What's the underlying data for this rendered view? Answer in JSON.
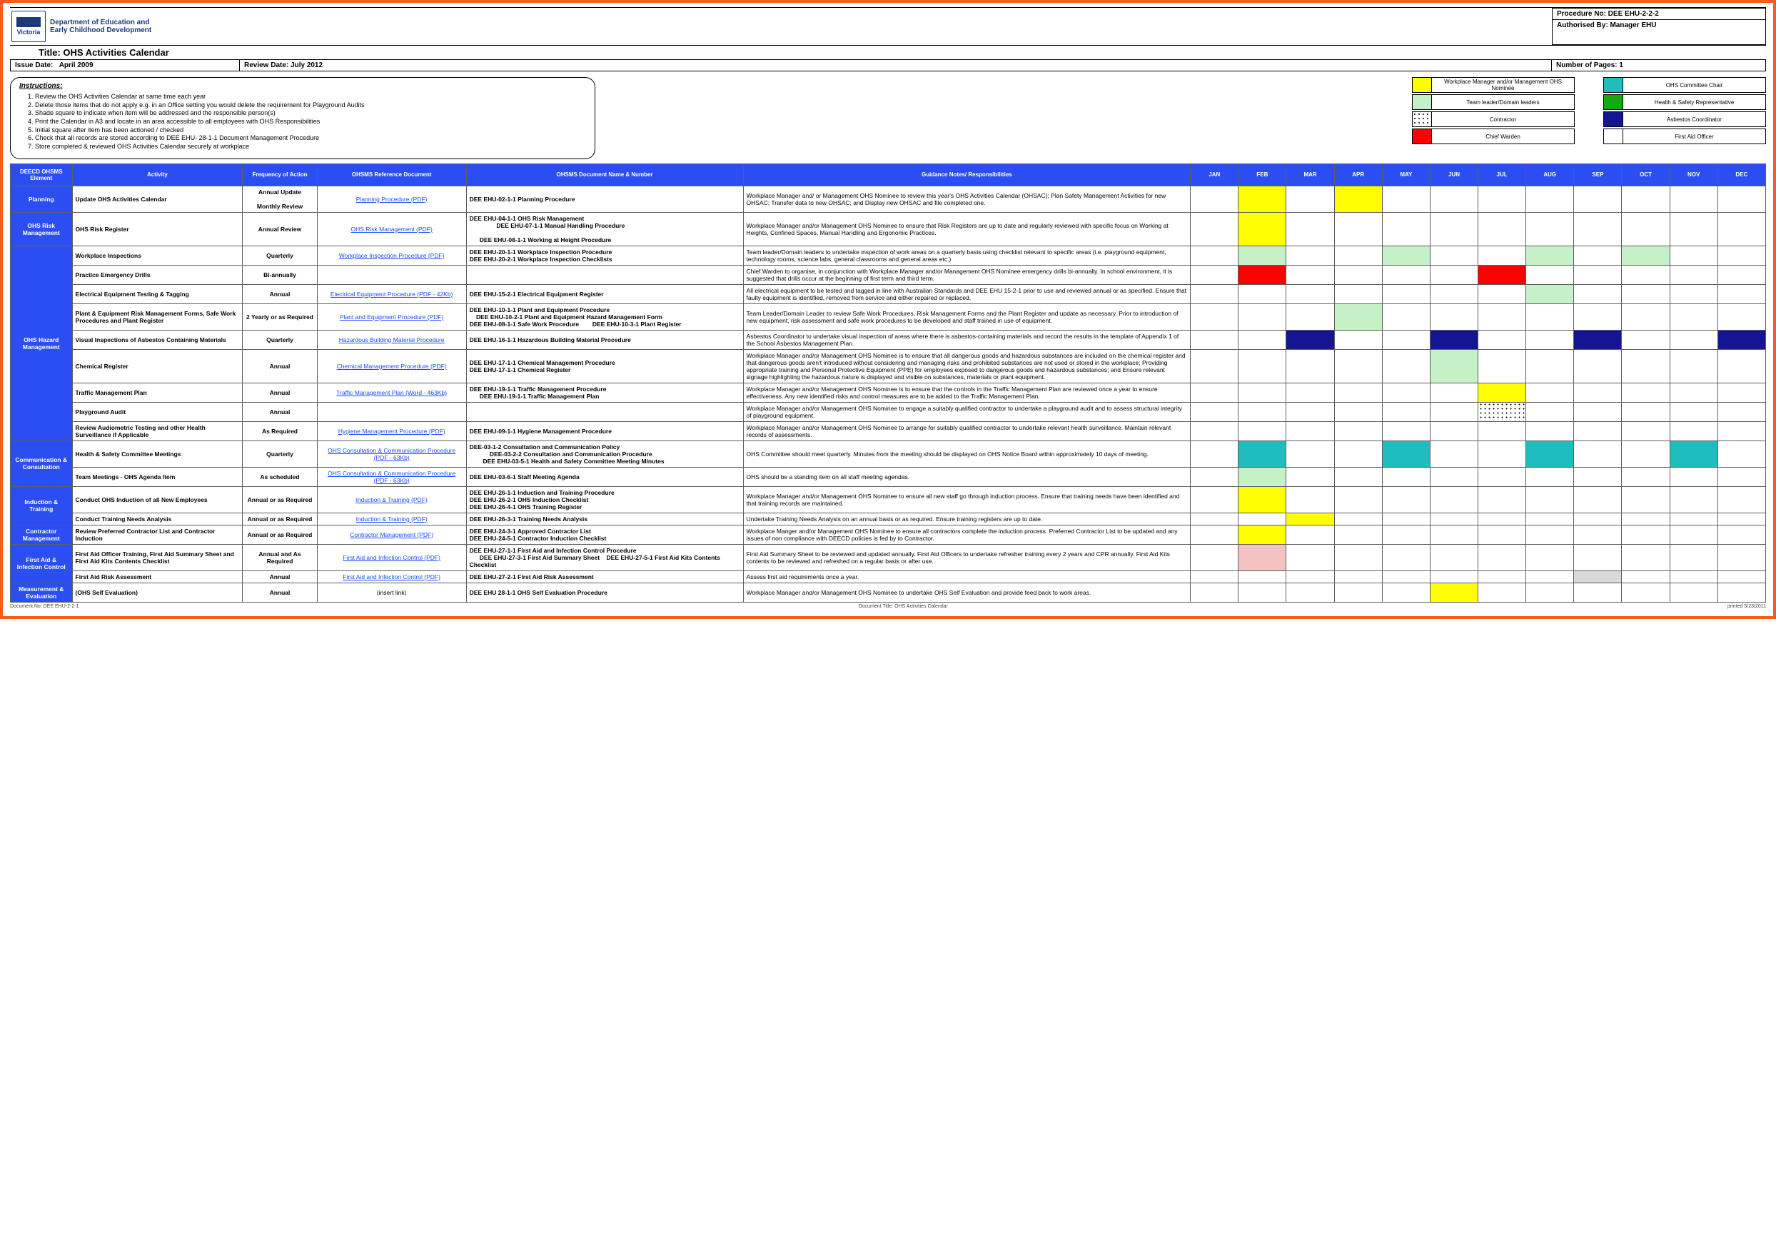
{
  "header": {
    "dept_line1": "Department of Education and",
    "dept_line2": "Early Childhood Development",
    "state": "Victoria",
    "title": "Title: OHS Activities Calendar",
    "procedure_no": "Procedure No: DEE EHU-2-2-2",
    "authorised_by": "Authorised By: Manager EHU",
    "issue_date_label": "Issue Date:",
    "issue_date_value": "April 2009",
    "review_date_label": "Review Date: July 2012",
    "pages_label": "Number of Pages: 1"
  },
  "instructions": {
    "heading": "Instructions:",
    "items": [
      "Review the OHS Activities Calendar at same time each year",
      "Delete those items that do not apply e.g. in an Office setting you would delete the requirement for Playground Audits",
      "Shade square to indicate when item will be addressed and the responsible person(s)",
      "Print the Calendar in A3 and locate in an area accessible to all employees with OHS Responsibilities",
      "Initial square after item has been actioned / checked",
      "Check that all records are stored according to DEE EHU- 28-1-1 Document Management Procedure",
      "Store completed & reviewed OHS Activities Calendar securely at workplace"
    ]
  },
  "legend": {
    "left": [
      {
        "sw": "sw-yellow",
        "label": "Workplace Manager and/or Management OHS Nominee"
      },
      {
        "sw": "sw-lgreen",
        "label": "Team leader/Domain leaders"
      },
      {
        "sw": "sw-dotted",
        "label": "Contractor"
      },
      {
        "sw": "sw-red",
        "label": "Chief Warden"
      }
    ],
    "right": [
      {
        "sw": "sw-teal",
        "label": "OHS Committee Chair"
      },
      {
        "sw": "sw-green",
        "label": "Health & Safety Representative"
      },
      {
        "sw": "sw-navy",
        "label": "Asbestos Coordinator"
      },
      {
        "sw": "sw-none",
        "label": "First Aid Officer"
      }
    ]
  },
  "columns": {
    "elem": "DEECD OHSMS Element",
    "activity": "Activity",
    "freq": "Frequency of Action",
    "ref": "OHSMS Reference Document",
    "docno": "OHSMS Document Name & Number",
    "guide": "Guidance Notes/ Responsibilities",
    "months": [
      "JAN",
      "FEB",
      "MAR",
      "APR",
      "MAY",
      "JUN",
      "JUL",
      "AUG",
      "SEP",
      "OCT",
      "NOV",
      "DEC"
    ]
  },
  "month_colors": {
    "yellow": "#ffff00",
    "lgreen": "#c6f0c6",
    "red": "#ff0000",
    "navy": "#141593",
    "teal": "#1fbdbd",
    "grey": "#d9d9d9",
    "pink": "#f4c2c2"
  },
  "groups": [
    {
      "element": "Planning",
      "rows": [
        {
          "activity": "Update OHS Activities Calendar",
          "freq": "Annual Update<br><br>Monthly Review",
          "ref": "Planning Procedure (PDF)",
          "doc": "DEE EHU-02-1-1 Planning Procedure",
          "guide": "Workplace Manager and/ or Management OHS Nominee to review this year's OHS Activities Calendar (OHSAC); Plan Safety Management Activities for new OHSAC; Transfer data to new OHSAC; and Display new OHSAC and file completed one.",
          "months": {
            "FEB": "yellow",
            "APR": "yellow"
          }
        }
      ]
    },
    {
      "element": "OHS Risk Management",
      "rows": [
        {
          "activity": "OHS Risk Register",
          "freq": "Annual Review",
          "ref": "OHS Risk Management (PDF)",
          "doc": "DEE EHU-04-1-1 OHS Risk Management<br>&nbsp;&nbsp;&nbsp;&nbsp;&nbsp;&nbsp;&nbsp;&nbsp;&nbsp;&nbsp;&nbsp;&nbsp;&nbsp;&nbsp;&nbsp;&nbsp;DEE EHU-07-1-1 Manual Handling Procedure<br><br>&nbsp;&nbsp;&nbsp;&nbsp;&nbsp;&nbsp;DEE EHU-08-1-1 Working at Height Procedure",
          "guide": "Workplace Manager and/or Management OHS Nominee to ensure that Risk Registers are up to date and regularly reviewed with specific focus on  Working at Heights, Confined Spaces, Manual Handling and Ergonomic Practices.",
          "months": {
            "FEB": "yellow"
          }
        }
      ]
    },
    {
      "element": "OHS Hazard Management",
      "rows": [
        {
          "activity": "Workplace Inspections",
          "freq": "Quarterly",
          "ref": "Workplace Inspection Procedure (PDF)",
          "doc": "DEE EHU-20-1-1 Workplace Inspection Procedure<br>DEE EHU-20-2-1 Workplace Inspection Checklists",
          "guide": "Team leader/Domain leaders to undertake inspection of work areas on a quarterly basis using checklist relevant to specific areas (i.e. playground equipment, technology rooms, science labs, general classrooms and general areas etc.)",
          "months": {
            "FEB": "lgreen",
            "MAY": "lgreen",
            "AUG": "lgreen",
            "OCT": "lgreen"
          }
        },
        {
          "activity": "Practice Emergency Drills",
          "freq": "Bi-annually",
          "ref": "",
          "doc": "",
          "guide": "Chief Warden to organise, in conjunction with Workplace Manager and/or Management OHS Nominee emergency drills bi-annually. In school environment, it is suggested that drills occur at the beginning of first term and third term.",
          "months": {
            "FEB": "red",
            "JUL": "red"
          }
        },
        {
          "activity": "Electrical Equipment Testing & Tagging",
          "freq": "Annual",
          "ref": "Electrical Equipment Procedure (PDF - 42Kb)",
          "doc": "DEE EHU-15-2-1 Electrical Equipment Register",
          "guide": "All electrical equipment to be tested and tagged in line with Australian Standards and DEE EHU 15-2-1 prior to use and reviewed annual or as specified. Ensure that faulty equipment is identified, removed from service and either repaired or replaced.",
          "months": {
            "AUG": "lgreen"
          }
        },
        {
          "activity": "Plant & Equipment Risk Management Forms, Safe Work Procedures and Plant Register",
          "freq": "2 Yearly or as Required",
          "ref": "Plant and Equipment Procedure (PDF)",
          "doc": "DEE EHU-10-1-1 Plant and Equipment Procedure<br>&nbsp;&nbsp;&nbsp;&nbsp;DEE EHU-10-2-1 Plant and Equipment Hazard Management Form<br>DEE EHU-08-1-1 Safe Work Procedure&nbsp;&nbsp;&nbsp;&nbsp;&nbsp;&nbsp;&nbsp;&nbsp;DEE EHU-10-3-1 Plant Register",
          "guide": "Team Leader/Domain Leader to review Safe Work Procedures, Risk Management Forms and the Plant Register and update as necessary.  Prior to introduction of new equipment, risk assessment and safe work procedures to be developed and staff trained in use of equipment.",
          "months": {
            "APR": "lgreen"
          }
        },
        {
          "activity": "Visual Inspections of Asbestos Containing Materials",
          "freq": "Quarterly",
          "ref": "Hazardous Building Material Procedure",
          "doc": "DEE EHU-16-1-1 Hazardous Building Material Procedure",
          "guide": "Asbestos Coordinator to undertake visual inspection of areas where there is asbestos-containing materials and record the results in the template of Appendix 1 of the School Asbestos Management Plan.",
          "months": {
            "MAR": "navy",
            "JUN": "navy",
            "SEP": "navy",
            "DEC": "navy"
          }
        },
        {
          "activity": "Chemical Register",
          "freq": "Annual",
          "ref": "Chemical Management Procedure (PDF)",
          "doc": "DEE EHU-17-1-1 Chemical Management Procedure<br>DEE EHU-17-1-1 Chemical Register",
          "guide": "Workplace Manager and/or Management OHS Nominee is to  ensure that all dangerous goods and hazardous substances are included on the chemical register and that dangerous goods aren't introduced without considering and managing risks and prohibited substances are not used or stored in the workplace; Providing appropriate training and Personal Protective Equipment (PPE) for employees exposed to dangerous goods and hazardous substances; and Ensure relevant signage highlighting the hazardous nature is displayed and visible on substances, materials or plant equipment.",
          "months": {
            "JUN": "lgreen"
          }
        },
        {
          "activity": "Traffic Management Plan",
          "freq": "Annual",
          "ref": "Traffic Management Plan (Word - 463Kb)",
          "doc": "DEE EHU-19-1-1 Traffic Management Procedure<br>&nbsp;&nbsp;&nbsp;&nbsp;&nbsp;&nbsp;DEE EHU-19-1-1 Traffic Management Plan",
          "guide": "Workplace Manager and/or Management OHS Nominee is to ensure that the controls in the Traffic Management Plan are reviewed once a year to ensure effectiveness. Any new identified risks and control measures are to be added to the Traffic Management Plan.",
          "months": {
            "JUL": "yellow"
          }
        },
        {
          "activity": "Playground Audit",
          "freq": "Annual",
          "ref": "",
          "doc": "",
          "guide": "Workplace Manager and/or Management OHS Nominee to engage a suitably qualified contractor to undertake a playground audit and to assess structural integrity of playground equipment.",
          "months": {
            "JUL": "dotted"
          }
        },
        {
          "activity": "Review Audiometric Testing and other Health Surveillance if Applicable",
          "freq": "As Required",
          "ref": "Hygiene Management Procedure (PDF)",
          "doc": "DEE EHU-09-1-1 Hygiene Management Procedure",
          "guide": "Workplace Manager and/or Management OHS Nominee to arrange for suitably qualified contractor to undertake relevant health surveillance. Maintain relevant records of assessments.",
          "months": {}
        }
      ]
    },
    {
      "element": "Communication & Consultation",
      "rows": [
        {
          "activity": "Health & Safety Committee Meetings",
          "freq": "Quarterly",
          "ref": "OHS Consultation & Communication Procedure (PDF - 63Kb)",
          "doc": "DEE-03-1-2 Consultation and Communication Policy<br>&nbsp;&nbsp;&nbsp;&nbsp;&nbsp;&nbsp;&nbsp;&nbsp;&nbsp;&nbsp;&nbsp;&nbsp;DEE-03-2-2 Consultation and Communication Procedure<br>&nbsp;&nbsp;&nbsp;&nbsp;&nbsp;&nbsp;&nbsp;&nbsp;DEE EHU-03-5-1 Health and Safety Committee Meeting Minutes",
          "guide": "OHS Committee should meet quarterly.  Minutes from the meeting should be displayed on OHS Notice Board within approximately 10 days of meeting.",
          "months": {
            "FEB": "teal",
            "MAY": "teal",
            "AUG": "teal",
            "NOV": "teal"
          }
        },
        {
          "activity": "Team Meetings - OHS Agenda Item",
          "freq": "As scheduled",
          "ref": "OHS Consultation & Communication Procedure (PDF - 63Kb)",
          "doc": "DEE EHU-03-6-1 Staff Meeting Agenda",
          "guide": "OHS should be a standing item on all staff meeting agendas.",
          "months": {
            "FEB": "lgreen"
          }
        }
      ]
    },
    {
      "element": "Induction & Training",
      "rows": [
        {
          "activity": "Conduct OHS Induction of all New Employees",
          "freq": "Annual or as Required",
          "ref": "Induction & Training (PDF)",
          "doc": "DEE EHU-26-1-1 Induction and Training Procedure<br>DEE EHU-26-2-1 OHS Induction Checklist<br>DEE EHU-26-4-1 OHS Training Register",
          "guide": "Workplace Manager and/or Management OHS Nominee to ensure all new staff go through induction process. Ensure that training needs have been identified and that training records are maintained.",
          "months": {
            "FEB": "yellow"
          }
        },
        {
          "activity": "Conduct Training Needs Analysis",
          "freq": "Annual or as Required",
          "ref": "Induction & Training (PDF)",
          "doc": "DEE EHU-26-3-1 Training Needs Analysis",
          "guide": "Undertake Training Needs Analysis on an annual basis or as required. Ensure training registers are up to date.",
          "months": {
            "MAR": "yellow"
          }
        }
      ]
    },
    {
      "element": "Contractor Management",
      "rows": [
        {
          "activity": "Review Preferred Contractor List and Contractor Induction",
          "freq": "Annual or as Required",
          "ref": "Contractor Management (PDF)",
          "doc": "DEE EHU-24-3-1 Approved Contractor List<br>DEE EHU-24-5-1 Contractor Induction Checklist",
          "guide": "Workplace Manger and/or Management OHS Nominee to ensure all contractors complete the induction process. Preferred Contractor List to be updated and any issues of non compliance with DEECD policies is fed by to Contractor.",
          "months": {
            "FEB": "yellow"
          }
        }
      ]
    },
    {
      "element": "First Aid & Infection Control",
      "rows": [
        {
          "activity": "First Aid Officer Training, First Aid Summary Sheet and First Aid Kits Contents Checklist",
          "freq": "Annual and  As Required",
          "ref": "First Aid and Infection Control (PDF)",
          "doc": "DEE EHU-27-1-1  First Aid and Infection Control Procedure<br>&nbsp;&nbsp;&nbsp;&nbsp;&nbsp;&nbsp;DEE EHU-27-3-1 First Aid Summary Sheet&nbsp;&nbsp;&nbsp;&nbsp;DEE EHU-27-5-1 First Aid Kits Contents Checklist",
          "guide": "First Aid Summary Sheet to be reviewed and updated annually. First Aid Officers to undertake refresher training every 2 years and CPR annually. First Aid Kits contents to be reviewed and refreshed on a regular basis or after use.",
          "months": {
            "FEB": "pink"
          }
        },
        {
          "activity": "First Aid Risk Assessment",
          "freq": "Annual",
          "ref": "First Aid and Infection Control (PDF)",
          "doc": "DEE EHU-27-2-1 First Aid Risk Assessment",
          "guide": "Assess first aid requirements once a year.",
          "months": {
            "SEP": "grey"
          }
        }
      ]
    },
    {
      "element": "Measurement & Evaluation",
      "rows": [
        {
          "activity": "(OHS Self Evaluation)",
          "freq": "Annual",
          "ref": "(insert link)",
          "ref_plain": true,
          "doc": "DEE EHU 28-1-1 OHS Self Evaluation Procedure",
          "guide": "Workplace Manager and/or Management OHS Nominee to undertake OHS Self Evaluation and provide feed back to work areas.",
          "months": {
            "JUN": "yellow"
          }
        }
      ]
    }
  ],
  "footer": {
    "left": "Document No: DEE EHU-2-2-1",
    "center": "Document Title: OHS Activities Calendar",
    "right": "printed 5/23/2011"
  }
}
